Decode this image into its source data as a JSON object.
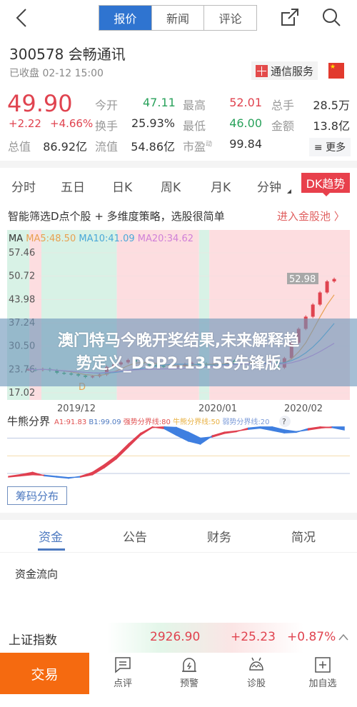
{
  "header": {
    "tabs": [
      {
        "label": "报价",
        "active": true
      },
      {
        "label": "新闻",
        "active": false
      },
      {
        "label": "评论",
        "active": false
      }
    ]
  },
  "stock": {
    "code_name": "300578 会畅通讯",
    "status": "已收盘 02-12 15:00",
    "industry_tag": "通信服务",
    "price": "49.90",
    "change": "+2.22",
    "change_pct": "+4.66%"
  },
  "quote": {
    "rows": [
      [
        {
          "label": "今开",
          "value": "47.11",
          "color": "green"
        },
        {
          "label": "最高",
          "value": "52.01",
          "color": "red"
        },
        {
          "label": "总手",
          "value": "28.5万",
          "color": "dark"
        }
      ],
      [
        {
          "label": "换手",
          "value": "25.93%",
          "color": "dark"
        },
        {
          "label": "最低",
          "value": "46.00",
          "color": "green"
        },
        {
          "label": "金额",
          "value": "13.8亿",
          "color": "dark"
        }
      ],
      [
        {
          "label": "总值",
          "value": "86.92亿",
          "color": "dark"
        },
        {
          "label": "流值",
          "value": "54.86亿",
          "color": "dark"
        },
        {
          "label": "市盈",
          "sup": "动",
          "value": "99.84",
          "color": "dark"
        }
      ]
    ],
    "more_label": "≡ 更多"
  },
  "ktabs": [
    "分时",
    "五日",
    "日K",
    "周K",
    "月K",
    "分钟",
    "DK趋势"
  ],
  "promo": {
    "text": "智能筛选D点个股 + 多维度策略，选股很简单",
    "link": "进入金股池 〉"
  },
  "chart_data": [
    {
      "type": "candlestick",
      "title": "MA",
      "legend": [
        {
          "name": "MA5",
          "value": "48.50",
          "color": "#e8a050"
        },
        {
          "name": "MA10",
          "value": "41.09",
          "color": "#4aa8d8"
        },
        {
          "name": "MA20",
          "value": "34.62",
          "color": "#d080d8"
        }
      ],
      "yticks": [
        "57.46",
        "50.72",
        "43.98",
        "37.24",
        "30.50",
        "23.76",
        "17.02"
      ],
      "xticks": [
        "2019/12",
        "2020/01",
        "2020/02"
      ],
      "ylim": [
        17.02,
        57.46
      ],
      "price_label": "52.98",
      "marker": "D",
      "zones": [
        {
          "from": 0,
          "to": 0.065,
          "c": "g"
        },
        {
          "from": 0.065,
          "to": 0.1,
          "c": "r"
        },
        {
          "from": 0.1,
          "to": 0.32,
          "c": "g"
        },
        {
          "from": 0.32,
          "to": 0.56,
          "c": "r"
        },
        {
          "from": 0.56,
          "to": 0.59,
          "c": "g"
        },
        {
          "from": 0.59,
          "to": 1,
          "c": "r"
        }
      ],
      "closes": [
        23.8,
        23.6,
        23.9,
        23.5,
        22.8,
        22.6,
        22.4,
        22.0,
        21.6,
        21.8,
        22.3,
        24.5,
        25.2,
        25.8,
        26.5,
        26.0,
        25.3,
        25.0,
        24.8,
        24.6,
        24.6,
        24.9,
        25.3,
        25.6,
        25.4,
        25.0,
        25.2,
        25.5,
        26.3,
        25.9,
        25.6,
        25.7,
        25.6,
        25.5,
        25.8,
        24.3,
        27.0,
        31.5,
        35.5,
        39.0,
        42.5,
        46.0,
        49.2,
        49.9
      ]
    },
    {
      "type": "area",
      "title": "牛熊分界",
      "legend": [
        {
          "name": "A1",
          "value": "91.83",
          "color": "#e05050"
        },
        {
          "name": "B1",
          "value": "99.09",
          "color": "#4d79c0"
        },
        {
          "name": "强势分界线",
          "value": "80",
          "color": "#e05050"
        },
        {
          "name": "牛熊分界线",
          "value": "50",
          "color": "#e8b040"
        },
        {
          "name": "弱势分界线",
          "value": "20",
          "color": "#7a9ad8"
        }
      ],
      "ylim": [
        0,
        100
      ],
      "a1": [
        15,
        18,
        22,
        16,
        14,
        12,
        15,
        22,
        35,
        50,
        70,
        88,
        99,
        96,
        85,
        75,
        70,
        84,
        90,
        92,
        95,
        97,
        93,
        89,
        90,
        96,
        99,
        98,
        94
      ],
      "b1": [
        14,
        16,
        18,
        17,
        15,
        13,
        14,
        18,
        30,
        45,
        65,
        85,
        98,
        99,
        98,
        90,
        80,
        82,
        88,
        91,
        97,
        99,
        99,
        94,
        91,
        94,
        97,
        99,
        99
      ]
    }
  ],
  "chips_label": "筹码分布",
  "btabs": [
    "资金",
    "公告",
    "财务",
    "简况"
  ],
  "flow_title": "资金流向",
  "index": {
    "name": "上证指数",
    "value": "2926.90",
    "change": "+25.23",
    "pct": "+0.87%"
  },
  "overlay": {
    "line1": "澳门特马今晚开奖结果,未来解释趋",
    "line2": "势定义_DSP2.13.55先锋版"
  },
  "bottom": {
    "trade": "交易",
    "items": [
      "点评",
      "预警",
      "诊股",
      "加自选"
    ]
  }
}
